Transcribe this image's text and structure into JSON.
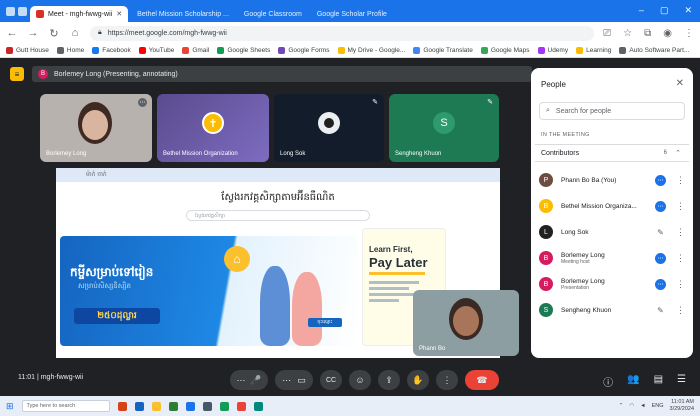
{
  "browser": {
    "tabs": [
      {
        "label": "Meet - mgh-fwwg-wii",
        "active": true
      },
      {
        "label": "Bethel Mission Scholarship ...",
        "active": false
      },
      {
        "label": "Google Classroom",
        "active": false
      },
      {
        "label": "Google Scholar Profile",
        "active": false
      }
    ],
    "url": "https://meet.google.com/mgh-fwwg-wii",
    "bookmarks": [
      "Gutt House",
      "Home",
      "Facebook",
      "YouTube",
      "Gmail",
      "Google Sheets",
      "Google Forms",
      "My Drive - Google...",
      "Google Translate",
      "Google Maps",
      "Udemy",
      "Learning",
      "Auto Software Part..."
    ]
  },
  "meet": {
    "presenter_banner": "Borlemey Long (Presenting, annotating)",
    "presenter_initial": "B",
    "tiles": [
      {
        "name": "Borlemey Long"
      },
      {
        "name": "Bethel Mission Organization"
      },
      {
        "name": "Long Sok"
      },
      {
        "name": "Sengheng Khuon",
        "initial": "S"
      }
    ],
    "self_view_name": "Phann Bo",
    "slide": {
      "top_label": "ម៉ាក់ ចាក់",
      "title": "ស្វែងរកវគ្គសិក្សាតាមអ៊ីនធឺណិត",
      "search_placeholder": "ស្វែងរកវគ្គសិក្សា",
      "banner_headline": "កម្ចីសម្រាប់ទៅរៀន",
      "banner_sub": "សម្រាប់សិស្សនិស្សិត",
      "banner_price": "២៥០ដុល្លារ",
      "banner_button": "ចុះឈ្មោះ",
      "card_line1": "Learn First,",
      "card_line2": "Pay Later"
    },
    "clock": "11:01",
    "meeting_code": "mgh-fwwg-wii",
    "controls": {
      "more": "⋯",
      "mic": "🎤",
      "camera": "▭",
      "captions": "CC",
      "emoji": "☺",
      "present": "⇪",
      "raise_hand": "✋",
      "more_options": "⋮",
      "end_call": "☎"
    },
    "right_controls": {
      "info": "ⓘ",
      "people": "👥",
      "chat": "▤",
      "activities": "☰"
    }
  },
  "people_panel": {
    "title": "People",
    "close": "✕",
    "search_placeholder": "Search for people",
    "section": "IN THE MEETING",
    "group": "Contributors",
    "count": "6",
    "participants": [
      {
        "name": "Phann Bo Ba (You)",
        "role": "",
        "color": "#6d4c41",
        "initial": "P",
        "speaking": true
      },
      {
        "name": "Bethel Mission Organiza...",
        "role": "",
        "color": "#fbbc04",
        "initial": "B",
        "speaking": true
      },
      {
        "name": "Long Sok",
        "role": "",
        "color": "#212121",
        "initial": "L",
        "speaking": false
      },
      {
        "name": "Borlemey Long",
        "role": "Meeting host",
        "color": "#d81b60",
        "initial": "B",
        "speaking": true
      },
      {
        "name": "Borlemey Long",
        "role": "Presentation",
        "color": "#d81b60",
        "initial": "B",
        "speaking": true
      },
      {
        "name": "Sengheng Khuon",
        "role": "",
        "color": "#1e7a53",
        "initial": "S",
        "speaking": false
      }
    ]
  },
  "taskbar": {
    "search_placeholder": "Type here to search",
    "time": "11:01 AM",
    "date": "3/29/2024",
    "lang": "ENG"
  }
}
